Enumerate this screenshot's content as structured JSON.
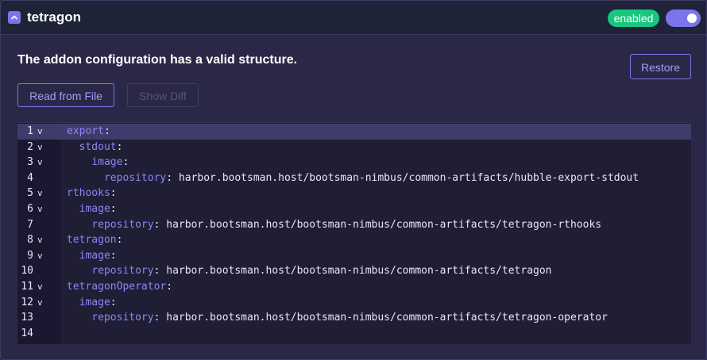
{
  "header": {
    "title": "tetragon",
    "badge": "enabled",
    "toggle_on": true,
    "colors": {
      "accent": "#7c74ea",
      "badge": "#18c77f"
    }
  },
  "status_message": "The addon configuration has a valid structure.",
  "buttons": {
    "restore": "Restore",
    "read_from_file": "Read from File",
    "show_diff": "Show Diff"
  },
  "editor": {
    "active_line": 1,
    "lines": [
      {
        "num": "1",
        "fold": true,
        "indent": "",
        "key": "export",
        "sep": ":",
        "value": ""
      },
      {
        "num": "2",
        "fold": true,
        "indent": "  ",
        "key": "stdout",
        "sep": ":",
        "value": ""
      },
      {
        "num": "3",
        "fold": true,
        "indent": "    ",
        "key": "image",
        "sep": ":",
        "value": ""
      },
      {
        "num": "4",
        "fold": false,
        "indent": "      ",
        "key": "repository",
        "sep": ":",
        "value": " harbor.bootsman.host/bootsman-nimbus/common-artifacts/hubble-export-stdout"
      },
      {
        "num": "5",
        "fold": true,
        "indent": "",
        "key": "rthooks",
        "sep": ":",
        "value": ""
      },
      {
        "num": "6",
        "fold": true,
        "indent": "  ",
        "key": "image",
        "sep": ":",
        "value": ""
      },
      {
        "num": "7",
        "fold": false,
        "indent": "    ",
        "key": "repository",
        "sep": ":",
        "value": " harbor.bootsman.host/bootsman-nimbus/common-artifacts/tetragon-rthooks"
      },
      {
        "num": "8",
        "fold": true,
        "indent": "",
        "key": "tetragon",
        "sep": ":",
        "value": ""
      },
      {
        "num": "9",
        "fold": true,
        "indent": "  ",
        "key": "image",
        "sep": ":",
        "value": ""
      },
      {
        "num": "10",
        "fold": false,
        "indent": "    ",
        "key": "repository",
        "sep": ":",
        "value": " harbor.bootsman.host/bootsman-nimbus/common-artifacts/tetragon"
      },
      {
        "num": "11",
        "fold": true,
        "indent": "",
        "key": "tetragonOperator",
        "sep": ":",
        "value": ""
      },
      {
        "num": "12",
        "fold": true,
        "indent": "  ",
        "key": "image",
        "sep": ":",
        "value": ""
      },
      {
        "num": "13",
        "fold": false,
        "indent": "    ",
        "key": "repository",
        "sep": ":",
        "value": " harbor.bootsman.host/bootsman-nimbus/common-artifacts/tetragon-operator"
      },
      {
        "num": "14",
        "fold": false,
        "indent": "",
        "key": "",
        "sep": "",
        "value": ""
      }
    ]
  }
}
